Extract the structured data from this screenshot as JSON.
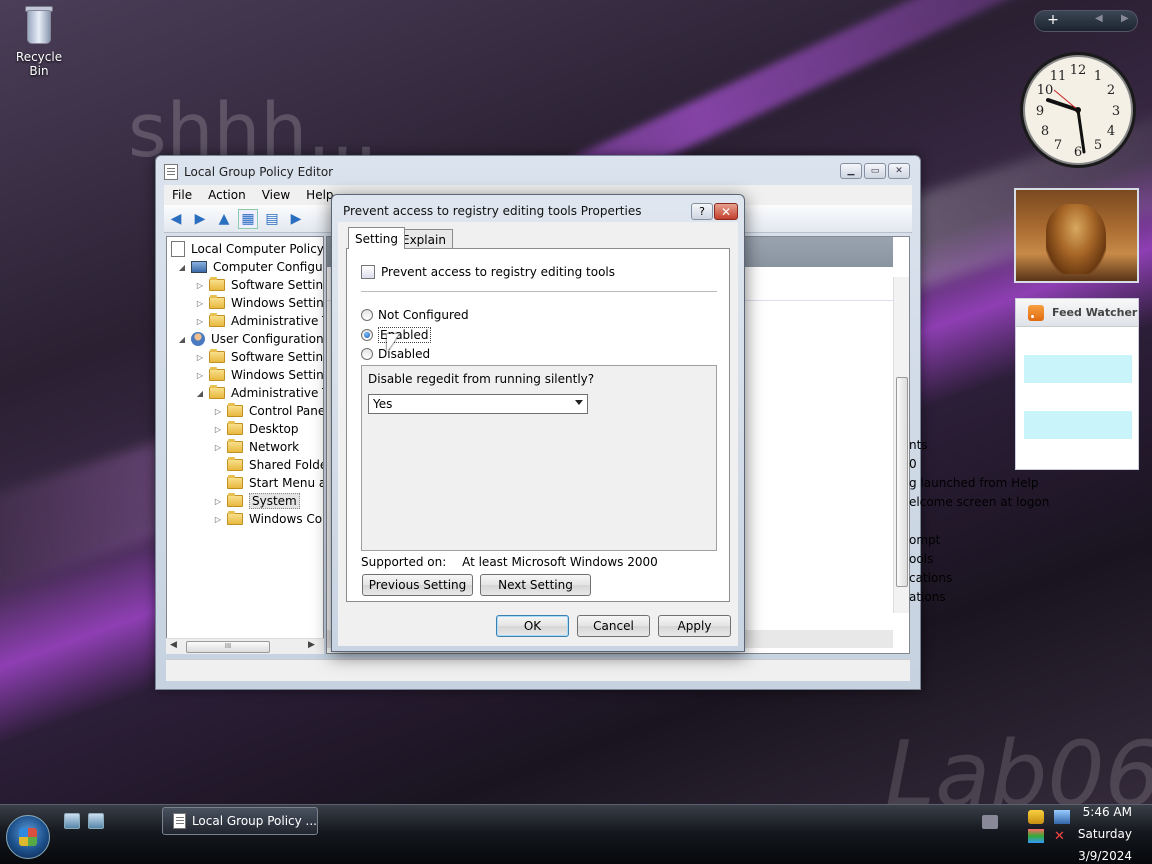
{
  "desktop": {
    "watermark_top": "shhh...",
    "watermark_bottom": "Lab06",
    "recycle_bin_label": "Recycle Bin"
  },
  "gadgets": {
    "add_label": "+",
    "feed_title": "Feed Watcher",
    "clock_time": "9:27"
  },
  "main_window": {
    "title": "Local Group Policy Editor",
    "menu": [
      "File",
      "Action",
      "View",
      "Help"
    ],
    "tree": [
      {
        "label": "Local Computer Policy",
        "icon": "policy-icon",
        "indent": 0,
        "expander": ""
      },
      {
        "label": "Computer Configura",
        "icon": "computer-icon",
        "indent": 1,
        "expander": "◢"
      },
      {
        "label": "Software Settings",
        "icon": "folder-icon",
        "indent": 2,
        "expander": "▷"
      },
      {
        "label": "Windows Setting",
        "icon": "folder-icon",
        "indent": 2,
        "expander": "▷"
      },
      {
        "label": "Administrative Te",
        "icon": "folder-icon",
        "indent": 2,
        "expander": "▷"
      },
      {
        "label": "User Configuration",
        "icon": "user-icon",
        "indent": 1,
        "expander": "◢"
      },
      {
        "label": "Software Settings",
        "icon": "folder-icon",
        "indent": 2,
        "expander": "▷"
      },
      {
        "label": "Windows Setting",
        "icon": "folder-icon",
        "indent": 2,
        "expander": "▷"
      },
      {
        "label": "Administrative Te",
        "icon": "folder-icon",
        "indent": 2,
        "expander": "◢"
      },
      {
        "label": "Control Panel",
        "icon": "folder-icon",
        "indent": 3,
        "expander": "▷"
      },
      {
        "label": "Desktop",
        "icon": "folder-icon",
        "indent": 3,
        "expander": "▷"
      },
      {
        "label": "Network",
        "icon": "folder-icon",
        "indent": 3,
        "expander": "▷"
      },
      {
        "label": "Shared Folder",
        "icon": "folder-icon",
        "indent": 3,
        "expander": ""
      },
      {
        "label": "Start Menu ar",
        "icon": "folder-icon",
        "indent": 3,
        "expander": ""
      },
      {
        "label": "System",
        "icon": "folder-icon",
        "indent": 3,
        "expander": "▷",
        "selected": true
      },
      {
        "label": "Windows Cor",
        "icon": "folder-icon",
        "indent": 3,
        "expander": "▷"
      }
    ],
    "right_pane_fragments": [
      "nts",
      "0",
      "g launched from Help",
      "elcome screen at logon",
      "ompt",
      "ools",
      "cations",
      "ations"
    ],
    "scroll_thumb_label": "III"
  },
  "dialog": {
    "title": "Prevent access to registry editing tools Properties",
    "help_label": "?",
    "close_label": "✕",
    "tabs": [
      "Setting",
      "Explain"
    ],
    "policy_name": "Prevent access to registry editing tools",
    "options": {
      "not_configured": "Not Configured",
      "enabled": "Enabled",
      "disabled": "Disabled",
      "selected": "enabled"
    },
    "option_label": "Disable regedit from running silently?",
    "option_value": "Yes",
    "supported_label": "Supported on:",
    "supported_value": "At least Microsoft Windows 2000",
    "buttons": {
      "previous": "Previous Setting",
      "next": "Next Setting",
      "ok": "OK",
      "cancel": "Cancel",
      "apply": "Apply"
    }
  },
  "taskbar": {
    "task_label": "Local Group Policy ...",
    "time": "5:46 AM",
    "day": "Saturday",
    "date": "3/9/2024"
  }
}
